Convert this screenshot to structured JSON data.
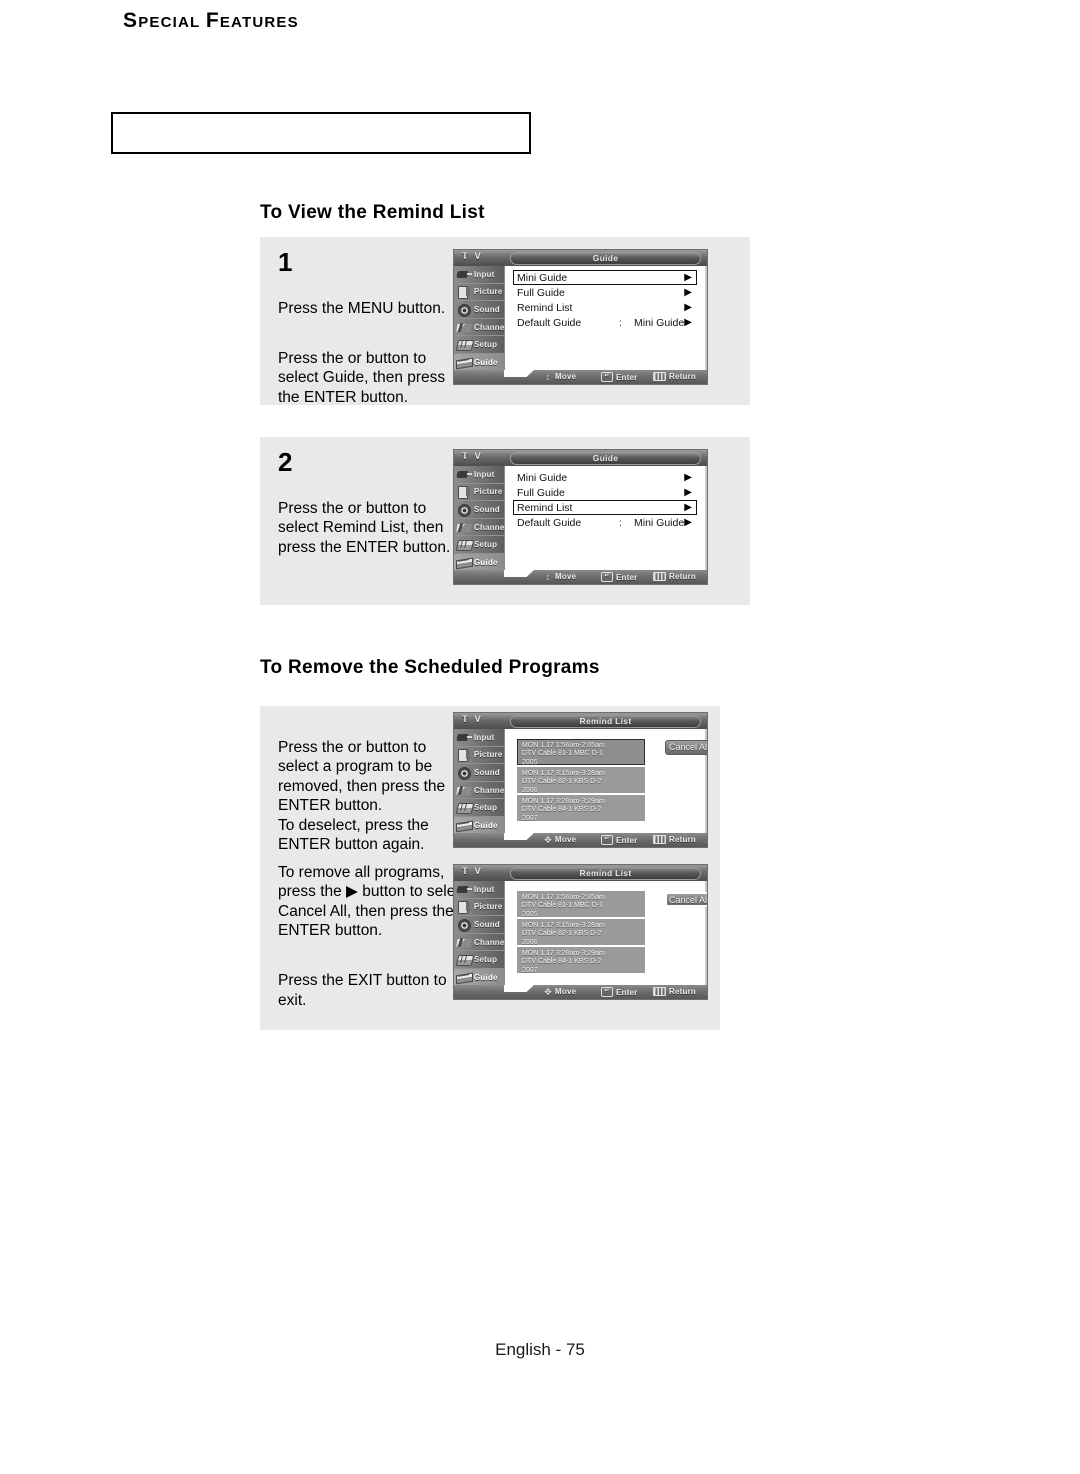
{
  "chapter": {
    "small": "PECIAL",
    "cap1": "S",
    "cap2": "F",
    "small2": "EATURES",
    "full": "SPECIAL FEATURES"
  },
  "sections": [
    {
      "id": "view-remind-list",
      "heading": "To View the Remind List"
    },
    {
      "id": "remove-scheduled-programs",
      "heading": "To Remove the Scheduled Programs"
    }
  ],
  "steps": [
    {
      "number": "1",
      "line1": "Press the MENU button.",
      "line2": "Press the  or  button to select Guide, then press the ENTER button."
    },
    {
      "number": "2",
      "line1": "Press the  or  button to select Remind List, then press the ENTER button."
    }
  ],
  "remove_text": {
    "para1": "Press the  or  button to select a program to be removed, then press the ENTER button.",
    "para2": "To deselect, press the ENTER button again.",
    "para3": "To remove all programs, press the ▶ button to select Cancel All, then press the ENTER button.",
    "para4": "Press the EXIT button to exit."
  },
  "osd": {
    "tv_label": "T V",
    "sidebar": [
      {
        "label": "Input",
        "icon": "input-icon"
      },
      {
        "label": "Picture",
        "icon": "picture-icon"
      },
      {
        "label": "Sound",
        "icon": "sound-icon"
      },
      {
        "label": "Channel",
        "icon": "channel-icon"
      },
      {
        "label": "Setup",
        "icon": "setup-icon"
      },
      {
        "label": "Guide",
        "icon": "guide-icon"
      }
    ],
    "hints": {
      "move": "Move",
      "enter": "Enter",
      "return": "Return",
      "enter_glyph": "↵"
    },
    "guide_title": "Guide",
    "remind_title": "Remind List",
    "guide_menu": [
      {
        "name": "Mini Guide",
        "colon": "",
        "value": "",
        "arrow": "▶"
      },
      {
        "name": "Full Guide",
        "colon": "",
        "value": "",
        "arrow": "▶"
      },
      {
        "name": "Remind List",
        "colon": "",
        "value": "",
        "arrow": "▶"
      },
      {
        "name": "Default Guide",
        "colon": ":",
        "value": "Mini Guide",
        "arrow": "▶"
      }
    ],
    "programs": [
      {
        "time": "MON 1.17 1:56am-2:05am",
        "channel": "DTV Cable 81-1 MBC D-1",
        "code": "2005"
      },
      {
        "time": "MON 1.17 3:15am-3:28am",
        "channel": "DTV Cable 82-1 KBS D-2",
        "code": "2006"
      },
      {
        "time": "MON 1.17 3:28am-3:29am",
        "channel": "DTV Cable 84-1 KBS D-2",
        "code": "2007"
      }
    ],
    "cancel_all": "Cancel All"
  },
  "screens": {
    "guide_step1_selected": "Mini Guide",
    "guide_step2_selected": "Remind List",
    "remind_a_selected_program": 0,
    "remind_b_selected_cancel_all": true
  },
  "footer": "English - 75"
}
